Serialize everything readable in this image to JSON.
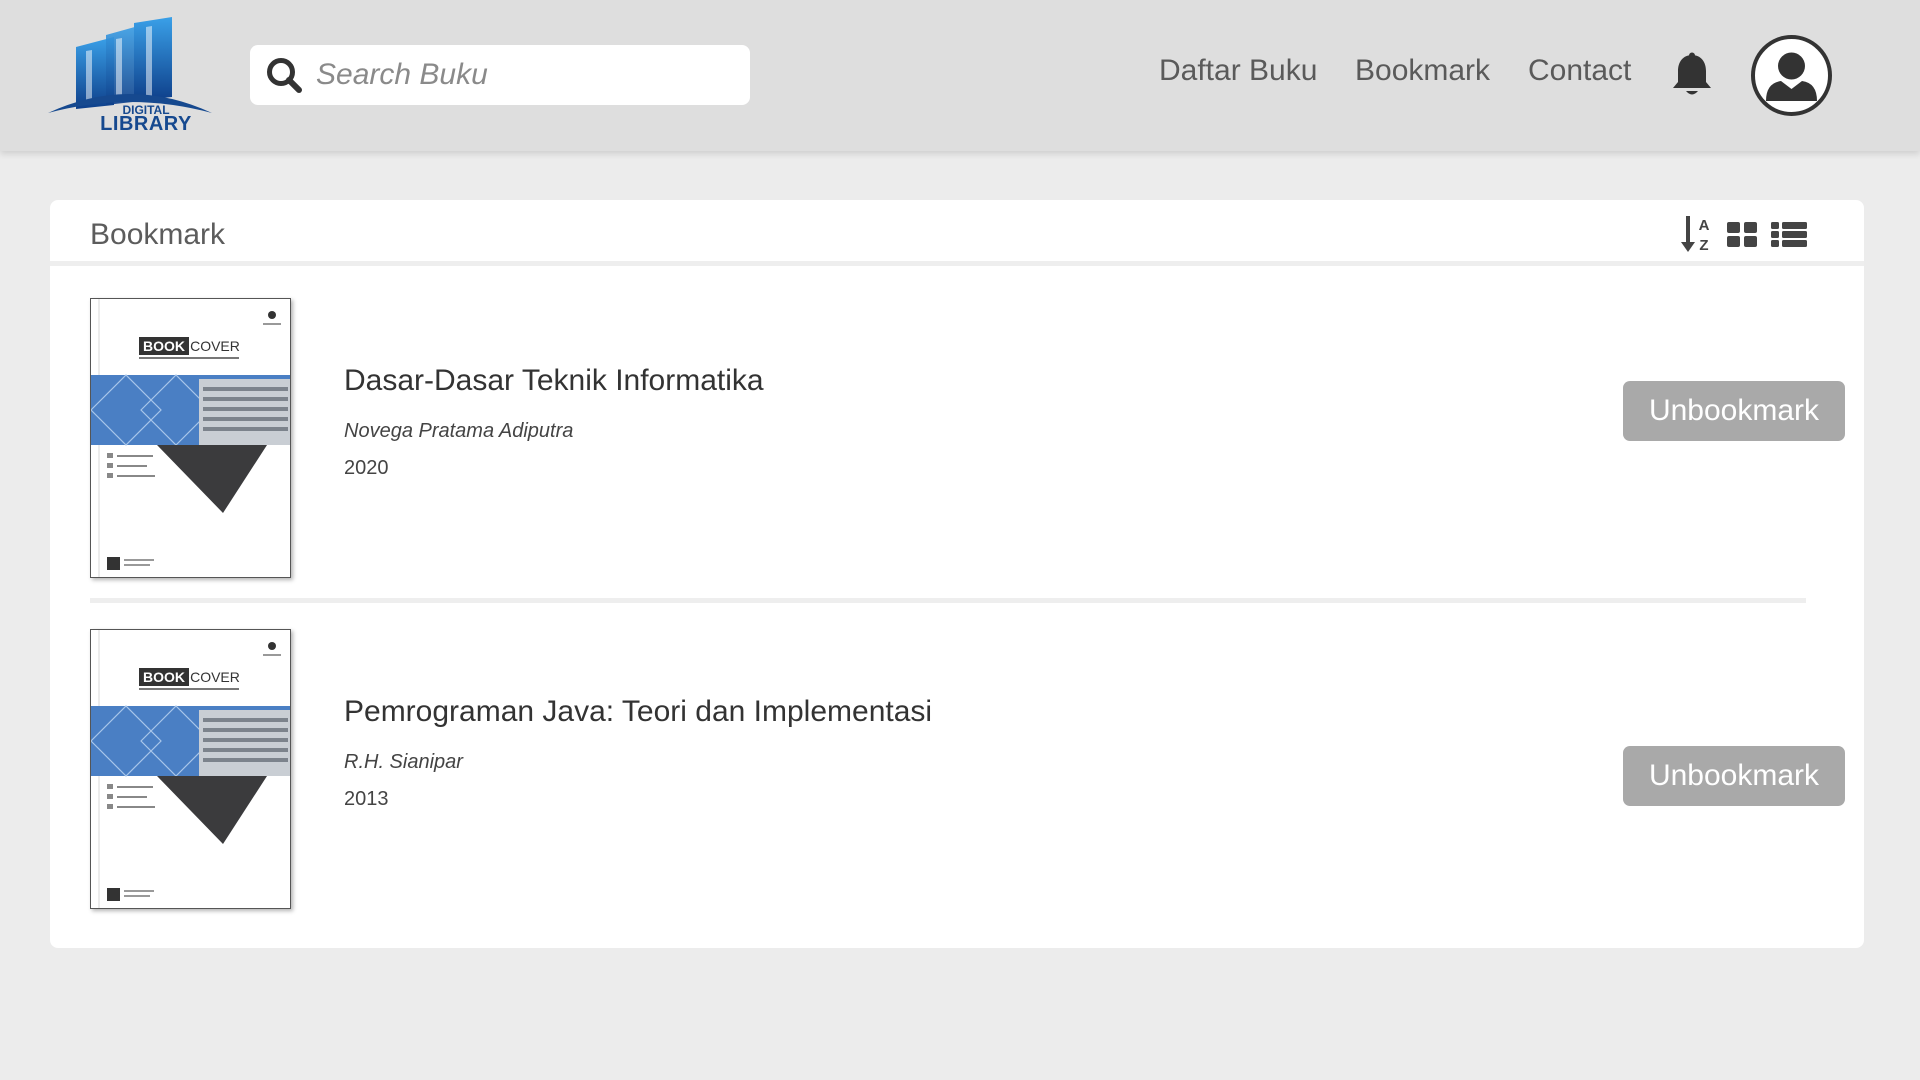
{
  "header": {
    "logo": {
      "line1": "DIGITAL",
      "line2": "LIBRARY",
      "color": "#16498f"
    },
    "search": {
      "placeholder": "Search Buku",
      "value": "",
      "icon": "search-icon"
    },
    "nav": [
      {
        "label": "Daftar Buku"
      },
      {
        "label": "Bookmark"
      },
      {
        "label": "Contact"
      }
    ],
    "notification_icon": "bell-icon",
    "profile_icon": "user-avatar-icon"
  },
  "panel": {
    "title": "Bookmark",
    "tools": [
      "sort-alpha-icon",
      "grid-view-icon",
      "list-view-icon"
    ]
  },
  "books": [
    {
      "title": "Dasar-Dasar Teknik Informatika",
      "author": "Novega Pratama Adiputra",
      "year": "2020",
      "cover_text": {
        "a": "BOOK",
        "b": "COVER"
      },
      "action": "Unbookmark"
    },
    {
      "title": "Pemrograman Java: Teori dan Implementasi",
      "author": "R.H. Sianipar",
      "year": "2013",
      "cover_text": {
        "a": "BOOK",
        "b": "COVER"
      },
      "action": "Unbookmark"
    }
  ],
  "colors": {
    "button": "#a9a9a9",
    "topbar": "#dedede",
    "background": "#ececec"
  }
}
